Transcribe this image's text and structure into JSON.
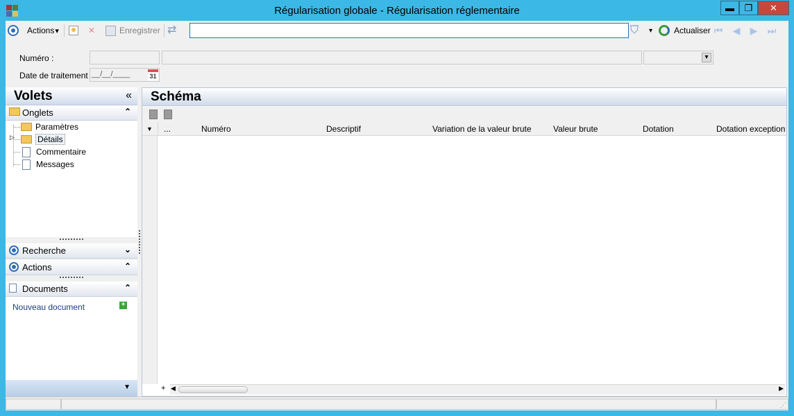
{
  "window": {
    "title": "Régularisation globale - Régularisation réglementaire",
    "minimize_glyph": "▬",
    "maximize_glyph": "❐",
    "close_glyph": "✕"
  },
  "toolbar": {
    "actions_label": "Actions",
    "actions_arrow": "▾",
    "save_label": "Enregistrer",
    "search_value": "",
    "refresh_label": "Actualiser",
    "filter_arrow": "▾",
    "nav_glyphs": [
      "⏮",
      "◀",
      "▶",
      "⏭"
    ]
  },
  "form": {
    "numero_label": "Numéro :",
    "date_label": "Date de traitement :",
    "date_value": "__/__/____",
    "calendar_day": "31",
    "dropdown_arrow": "▾"
  },
  "left_panel": {
    "title": "Volets",
    "collapse_glyph": "«",
    "tabs_section": "Onglets",
    "up_glyph": "⌃",
    "down_glyph": "⌄",
    "tree_items": [
      "Paramètres",
      "Détails",
      "Commentaire",
      "Messages"
    ],
    "expander_glyph": "▷",
    "search_section": "Recherche",
    "actions_section": "Actions",
    "documents_section": "Documents",
    "new_document": "Nouveau document",
    "add_glyph": "+",
    "bottom_arrow": "▼"
  },
  "main": {
    "title": "Schéma",
    "row_menu_glyph": "▼",
    "add_row_glyph": "+",
    "scroll_left_glyph": "◀",
    "scroll_right_glyph": "▶",
    "columns": [
      "...",
      "Numéro",
      "Descriptif",
      "Variation de la valeur brute",
      "Valeur brute",
      "Dotation",
      "Dotation exception"
    ]
  },
  "colors": {
    "title_bar": "#3bb8e6",
    "accent": "#2e6eb5",
    "close_button": "#c7483b"
  }
}
